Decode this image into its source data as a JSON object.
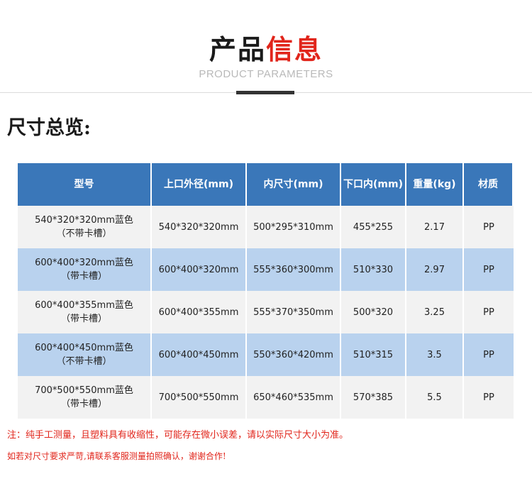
{
  "header": {
    "title_part1": "产品",
    "title_part2": "信息",
    "subtitle": "PRODUCT PARAMETERS"
  },
  "section": {
    "title": "尺寸总览:"
  },
  "table": {
    "columns": [
      "型号",
      "上口外径(mm)",
      "内尺寸(mm)",
      "下口内(mm)",
      "重量(kg)",
      "材质"
    ],
    "rows": [
      {
        "model_line1": "540*320*320mm蓝色",
        "model_line2": "（不带卡槽）",
        "outer": "540*320*320mm",
        "inner": "500*295*310mm",
        "bottom": "455*255",
        "weight": "2.17",
        "material": "PP"
      },
      {
        "model_line1": "600*400*320mm蓝色",
        "model_line2": "（带卡槽）",
        "outer": "600*400*320mm",
        "inner": "555*360*300mm",
        "bottom": "510*330",
        "weight": "2.97",
        "material": "PP"
      },
      {
        "model_line1": "600*400*355mm蓝色",
        "model_line2": "（带卡槽）",
        "outer": "600*400*355mm",
        "inner": "555*370*350mm",
        "bottom": "500*320",
        "weight": "3.25",
        "material": "PP"
      },
      {
        "model_line1": "600*400*450mm蓝色",
        "model_line2": "（不带卡槽）",
        "outer": "600*400*450mm",
        "inner": "550*360*420mm",
        "bottom": "510*315",
        "weight": "3.5",
        "material": "PP"
      },
      {
        "model_line1": "700*500*550mm蓝色",
        "model_line2": "（带卡槽）",
        "outer": "700*500*550mm",
        "inner": "650*460*535mm",
        "bottom": "570*385",
        "weight": "5.5",
        "material": "PP"
      }
    ]
  },
  "notes": {
    "note1": "注：纯手工测量，且塑料具有收缩性，可能存在微小误差，请以实际尺寸大小为准。",
    "note2": "如若对尺寸要求严苛,请联系客服测量拍照确认，谢谢合作!"
  },
  "colors": {
    "accent_red": "#e1251b",
    "header_blue": "#3a77b9",
    "row_light": "#f2f2f2",
    "row_blue": "#b9d2ee"
  }
}
